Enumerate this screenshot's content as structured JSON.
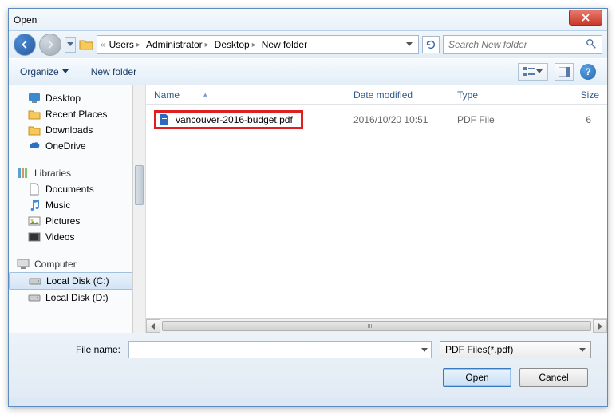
{
  "window": {
    "title": "Open"
  },
  "breadcrumb": {
    "prefix": "«",
    "segments": [
      "Users",
      "Administrator",
      "Desktop",
      "New folder"
    ]
  },
  "search": {
    "placeholder": "Search New folder"
  },
  "toolbar": {
    "organize": "Organize",
    "new_folder": "New folder"
  },
  "tree": {
    "favorites": {
      "desktop": "Desktop",
      "recent": "Recent Places",
      "downloads": "Downloads",
      "onedrive": "OneDrive"
    },
    "libraries": {
      "header": "Libraries",
      "documents": "Documents",
      "music": "Music",
      "pictures": "Pictures",
      "videos": "Videos"
    },
    "computer": {
      "header": "Computer",
      "c": "Local Disk (C:)",
      "d": "Local Disk (D:)"
    }
  },
  "columns": {
    "name": "Name",
    "date": "Date modified",
    "type": "Type",
    "size": "Size"
  },
  "files": [
    {
      "name": "vancouver-2016-budget.pdf",
      "date": "2016/10/20 10:51",
      "type": "PDF File",
      "size": "6"
    }
  ],
  "bottom": {
    "filename_label": "File name:",
    "filename_value": "",
    "filter": "PDF Files(*.pdf)",
    "open": "Open",
    "cancel": "Cancel"
  }
}
